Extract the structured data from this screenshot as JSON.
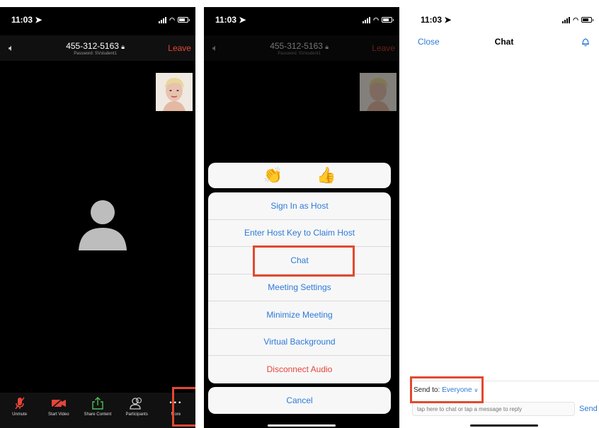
{
  "status": {
    "time": "11:03 ➤"
  },
  "meeting": {
    "id": "455-312-5163",
    "password": "Password: SVstudent1",
    "leave": "Leave",
    "speaker_icon": "speaker-icon",
    "lock_icon": "lock-icon"
  },
  "toolbar": {
    "unmute": "Unmute",
    "start_video": "Start Video",
    "share_content": "Share Content",
    "participants": "Participants",
    "more": "More"
  },
  "reactions": {
    "clap": "👏",
    "thumbs": "👍"
  },
  "sheet": {
    "items": [
      "Sign In as Host",
      "Enter Host Key to Claim Host",
      "Chat",
      "Meeting Settings",
      "Minimize Meeting",
      "Virtual Background",
      "Disconnect Audio"
    ],
    "cancel": "Cancel"
  },
  "chat": {
    "close": "Close",
    "title": "Chat",
    "send_to_label": "Send to:",
    "send_to_value": "Everyone",
    "input_placeholder": "tap here to chat or tap a message to reply",
    "send": "Send"
  },
  "colors": {
    "accent": "#2d7ad8",
    "danger": "#e5453b",
    "highlight": "#e2492f"
  }
}
